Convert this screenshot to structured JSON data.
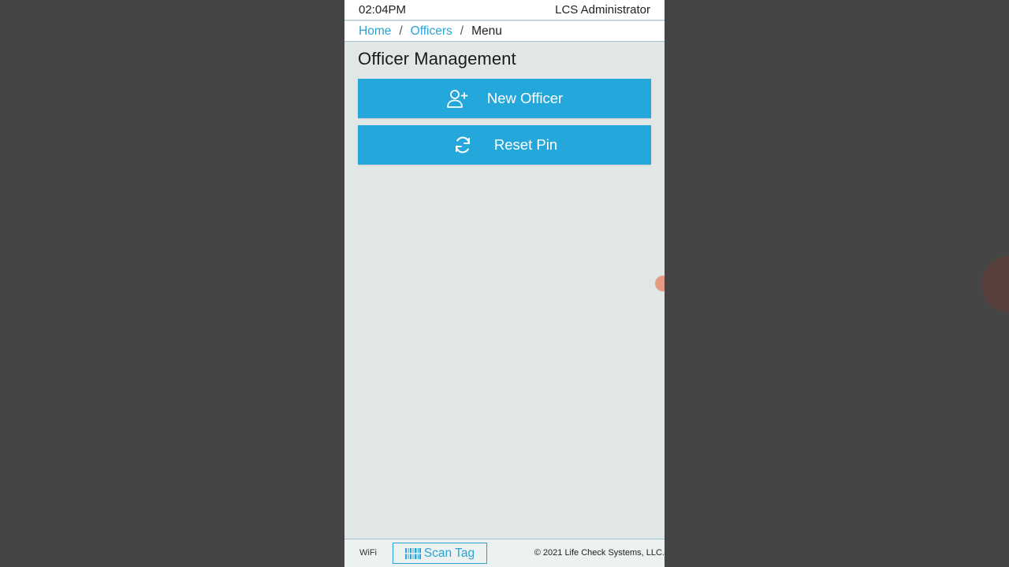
{
  "status_bar": {
    "time": "02:04PM",
    "user": "LCS Administrator"
  },
  "breadcrumb": {
    "items": [
      "Home",
      "Officers"
    ],
    "separator": "/",
    "current": "Menu"
  },
  "page": {
    "title": "Officer Management"
  },
  "actions": {
    "new_officer": {
      "label": "New Officer",
      "icon": "user-plus-icon"
    },
    "reset_pin": {
      "label": "Reset Pin",
      "icon": "refresh-icon"
    }
  },
  "footer": {
    "wifi": "WiFi",
    "scan_tag": {
      "label": "Scan Tag",
      "icon": "barcode-icon"
    },
    "copyright": "© 2021 Life Check Systems, LLC."
  },
  "colors": {
    "accent": "#24a7da",
    "link": "#2aa3d2",
    "background": "#e1e7e6",
    "letterbox": "#454545"
  }
}
